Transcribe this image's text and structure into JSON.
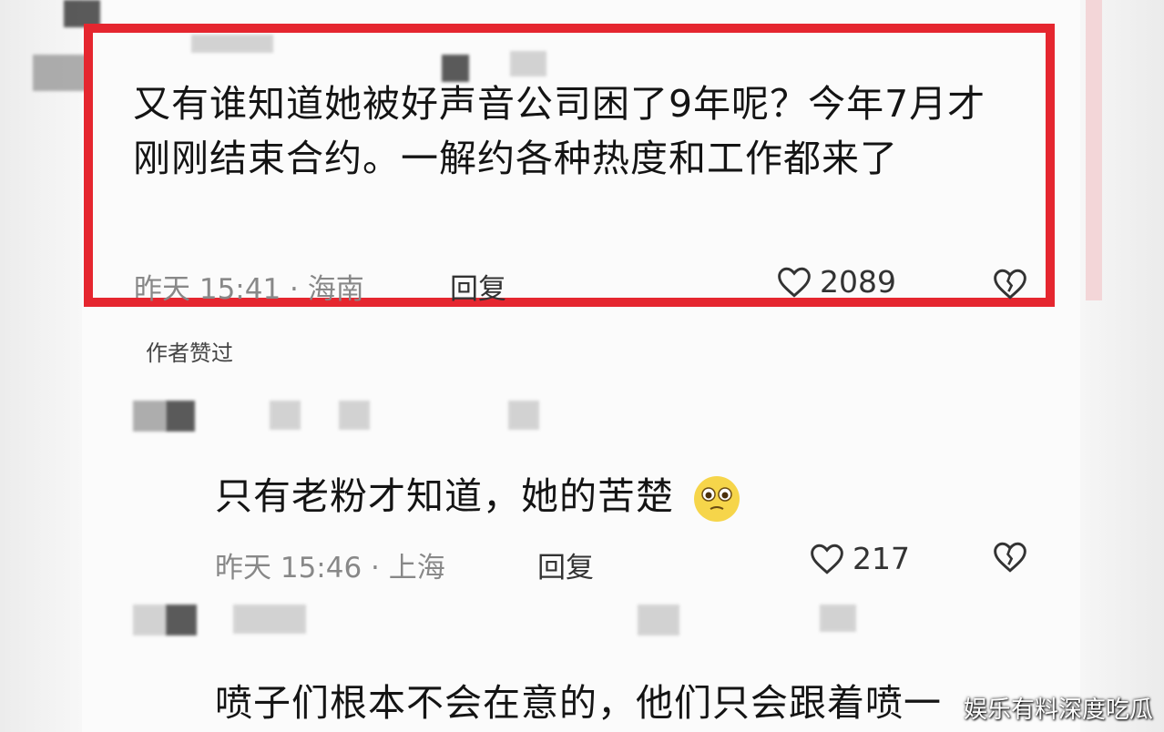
{
  "comments": [
    {
      "text": "又有谁知道她被好声音公司困了9年呢？今年7月才刚刚结束合约。一解约各种热度和工作都来了",
      "meta": "昨天 15:41 · 海南",
      "reply_label": "回复",
      "likes": "2089",
      "highlighted": true
    },
    {
      "text": "只有老粉才知道，她的苦楚",
      "meta": "昨天 15:46 · 上海",
      "reply_label": "回复",
      "likes": "217"
    },
    {
      "text": "喷子们根本不会在意的，他们只会跟着喷一"
    }
  ],
  "author_liked": "作者赞过",
  "watermark": "娱乐有料深度吃瓜",
  "colors": {
    "highlight_border": "#e5262f",
    "text": "#141414",
    "meta": "#888888"
  },
  "icons": {
    "like": "heart-outline-icon",
    "dislike": "broken-heart-icon",
    "emoji": "teary-face-emoji"
  }
}
